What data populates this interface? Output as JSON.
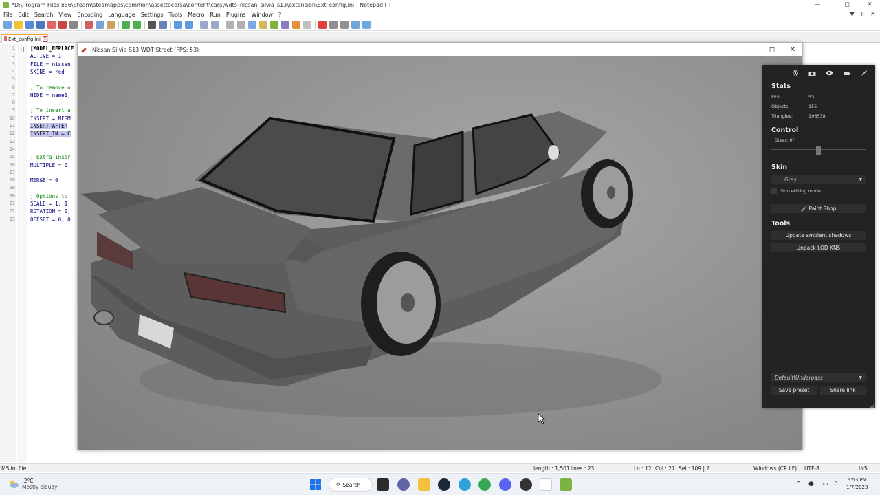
{
  "notepad": {
    "title": "*D:\\Program Files x86\\Steam\\steamapps\\common\\assettocorsa\\content\\cars\\wdts_nissan_silvia_s13\\extension\\Ext_config.ini - Notepad++",
    "menu": [
      "File",
      "Edit",
      "Search",
      "View",
      "Encoding",
      "Language",
      "Settings",
      "Tools",
      "Macro",
      "Run",
      "Plugins",
      "Window",
      "?"
    ],
    "tab_label": "Ext_config.ini",
    "lines": [
      {
        "n": "1",
        "text": "[MODEL_REPLACE",
        "kind": "sec"
      },
      {
        "n": "2",
        "text": "ACTIVE = 1",
        "kind": "key"
      },
      {
        "n": "3",
        "text": "FILE = nissan",
        "kind": "key"
      },
      {
        "n": "4",
        "text": "SKINS = red",
        "kind": "key"
      },
      {
        "n": "5",
        "text": "",
        "kind": "key"
      },
      {
        "n": "6",
        "text": "; To remove o",
        "kind": "cmt"
      },
      {
        "n": "7",
        "text": "HIDE = name1,",
        "kind": "key"
      },
      {
        "n": "8",
        "text": "",
        "kind": "key"
      },
      {
        "n": "9",
        "text": "; To insert a",
        "kind": "cmt"
      },
      {
        "n": "10",
        "text": "INSERT = NFSM",
        "kind": "key"
      },
      {
        "n": "11",
        "text": "INSERT_AFTER",
        "kind": "sel"
      },
      {
        "n": "12",
        "text": "INSERT_IN = C",
        "kind": "sel"
      },
      {
        "n": "13",
        "text": "",
        "kind": "key"
      },
      {
        "n": "14",
        "text": "",
        "kind": "key"
      },
      {
        "n": "15",
        "text": "; Extra inser",
        "kind": "cmt"
      },
      {
        "n": "16",
        "text": "MULTIPLE = 0",
        "kind": "key"
      },
      {
        "n": "17",
        "text": "",
        "kind": "key"
      },
      {
        "n": "18",
        "text": "MERGE = 0",
        "kind": "key"
      },
      {
        "n": "19",
        "text": "",
        "kind": "key"
      },
      {
        "n": "20",
        "text": "; Options to",
        "kind": "cmt"
      },
      {
        "n": "21",
        "text": "SCALE = 1, 1,",
        "kind": "key"
      },
      {
        "n": "22",
        "text": "ROTATION = 0,",
        "kind": "key"
      },
      {
        "n": "23",
        "text": "OFFSET = 0, 0",
        "kind": "key"
      }
    ],
    "status": {
      "lang": "MS ini file",
      "length": "length : 1,501",
      "lines": "lines : 23",
      "ln": "Ln : 12",
      "col": "Col : 27",
      "sel": "Sel : 109 | 2",
      "eol": "Windows (CR LF)",
      "enc": "UTF-8",
      "mode": "INS"
    }
  },
  "csp": {
    "title": "Nissan Silvia S13 WDT Street (FPS: 53)",
    "panel": {
      "stats_heading": "Stats",
      "stats": [
        {
          "label": "FPS:",
          "value": "53"
        },
        {
          "label": "Objects:",
          "value": "155"
        },
        {
          "label": "Triangles:",
          "value": "196538"
        }
      ],
      "control_heading": "Control",
      "steer_label": "Steer: 0°",
      "skin_heading": "Skin",
      "skin_value": "Gray",
      "skin_editing": "Skin editing mode",
      "paint_shop": "Paint Shop",
      "tools_heading": "Tools",
      "tool_buttons": [
        "Update ambient shadows",
        "Unpack LOD KN5"
      ],
      "preset_value": "Default\\Underpass",
      "save_preset": "Save preset",
      "share_link": "Share link"
    }
  },
  "taskbar": {
    "temp": "-2°C",
    "weather": "Mostly cloudy",
    "search": "Search",
    "time": "6:53 PM",
    "date": "1/7/2023"
  },
  "colors": {
    "panel_bg": "#232323",
    "tab_accent": "#f2a33a",
    "selection": "#c0c4ee"
  }
}
